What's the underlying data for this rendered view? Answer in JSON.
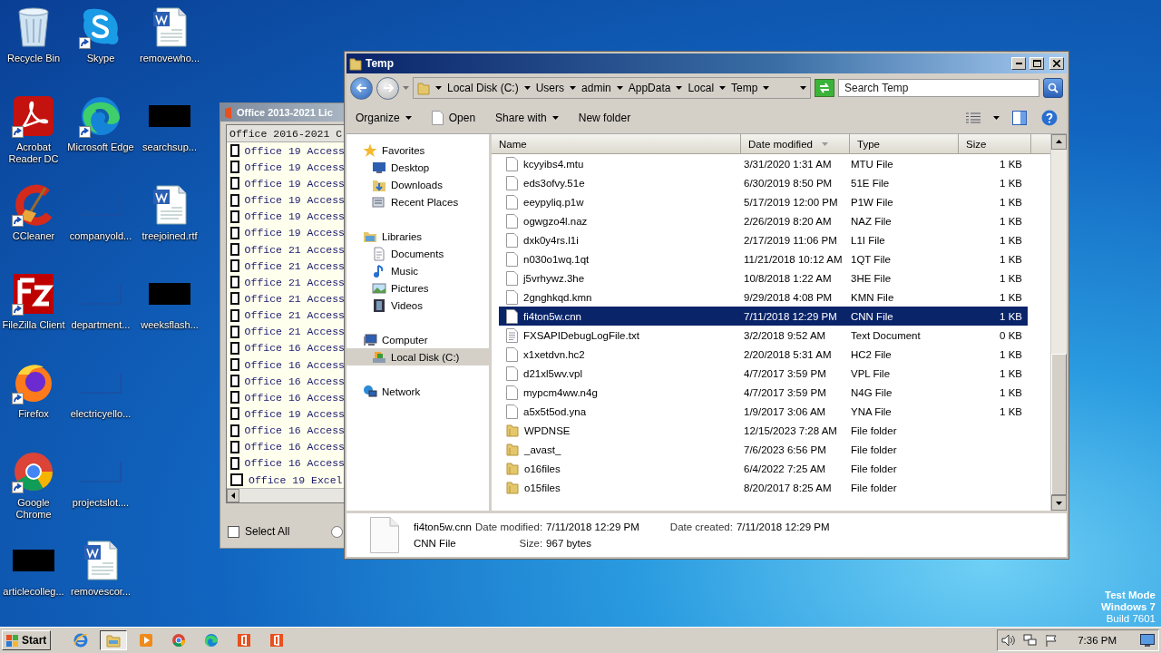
{
  "desktop": {
    "columns": [
      [
        {
          "label": "Recycle Bin",
          "kind": "recycle",
          "shortcut": false
        },
        {
          "label": "Acrobat Reader DC",
          "kind": "acrobat",
          "shortcut": true
        },
        {
          "label": "CCleaner",
          "kind": "ccleaner",
          "shortcut": true
        },
        {
          "label": "FileZilla Client",
          "kind": "filezilla",
          "shortcut": true
        },
        {
          "label": "Firefox",
          "kind": "firefox",
          "shortcut": true
        },
        {
          "label": "Google Chrome",
          "kind": "chrome",
          "shortcut": true
        },
        {
          "label": "articlecolleg...",
          "kind": "dark",
          "shortcut": false
        }
      ],
      [
        {
          "label": "Skype",
          "kind": "skype",
          "shortcut": true
        },
        {
          "label": "Microsoft Edge",
          "kind": "edge",
          "shortcut": true
        },
        {
          "label": "companyold...",
          "kind": "outline",
          "shortcut": false
        },
        {
          "label": "department...",
          "kind": "outline",
          "shortcut": false
        },
        {
          "label": "electricyello...",
          "kind": "outline",
          "shortcut": false
        },
        {
          "label": "projectslot....",
          "kind": "outline",
          "shortcut": false
        },
        {
          "label": "removescor...",
          "kind": "word",
          "shortcut": false
        }
      ],
      [
        {
          "label": "removewho...",
          "kind": "word",
          "shortcut": false
        },
        {
          "label": "searchsup...",
          "kind": "dark",
          "shortcut": false
        },
        {
          "label": "treejoined.rtf",
          "kind": "word",
          "shortcut": false
        },
        {
          "label": "weeksflash...",
          "kind": "dark",
          "shortcut": false
        }
      ]
    ],
    "watermark": [
      "Test Mode",
      "Windows 7",
      "Build 7601"
    ]
  },
  "office_window": {
    "title": "Office 2013-2021 Lic",
    "list_header": "Office 2016-2021 C",
    "items": [
      {
        "label": "Office 19 Access",
        "checked": false
      },
      {
        "label": "Office 19 Access",
        "checked": false
      },
      {
        "label": "Office 19 Access",
        "checked": false
      },
      {
        "label": "Office 19 Access",
        "checked": false
      },
      {
        "label": "Office 19 Access",
        "checked": false
      },
      {
        "label": "Office 19 Access",
        "checked": false
      },
      {
        "label": "Office 21 Access",
        "checked": false
      },
      {
        "label": "Office 21 Access",
        "checked": false
      },
      {
        "label": "Office 21 Access",
        "checked": false
      },
      {
        "label": "Office 21 Access",
        "checked": false
      },
      {
        "label": "Office 21 Access",
        "checked": false
      },
      {
        "label": "Office 21 Access",
        "checked": false
      },
      {
        "label": "Office 16 Access",
        "checked": false
      },
      {
        "label": "Office 16 Access",
        "checked": false
      },
      {
        "label": "Office 16 Access",
        "checked": false
      },
      {
        "label": "Office 16 Access",
        "checked": false
      },
      {
        "label": "Office 19 Access",
        "checked": false
      },
      {
        "label": "Office 16 Access",
        "checked": false
      },
      {
        "label": "Office 16 Access",
        "checked": false
      },
      {
        "label": "Office 16 Access",
        "checked": false
      },
      {
        "label": "Office 19 Excel",
        "checked": false
      }
    ],
    "select_all": {
      "label": "Select All",
      "checked": false
    },
    "radio": {
      "selected": false
    }
  },
  "explorer": {
    "title": "Temp",
    "breadcrumb": [
      "Local Disk (C:)",
      "Users",
      "admin",
      "AppData",
      "Local",
      "Temp"
    ],
    "search": {
      "placeholder": "Search Temp"
    },
    "toolbar": [
      {
        "label": "Organize",
        "kind": "menu"
      },
      {
        "label": "Open",
        "kind": "open"
      },
      {
        "label": "Share with",
        "kind": "menu"
      },
      {
        "label": "New folder",
        "kind": "plain"
      }
    ],
    "nav": [
      {
        "label": "Favorites",
        "kind": "star",
        "selected": false,
        "children": [
          {
            "label": "Desktop",
            "kind": "desktop",
            "selected": false
          },
          {
            "label": "Downloads",
            "kind": "downloads",
            "selected": false
          },
          {
            "label": "Recent Places",
            "kind": "recent",
            "selected": false
          }
        ]
      },
      {
        "label": "Libraries",
        "kind": "libraries",
        "selected": false,
        "children": [
          {
            "label": "Documents",
            "kind": "documents",
            "selected": false
          },
          {
            "label": "Music",
            "kind": "music",
            "selected": false
          },
          {
            "label": "Pictures",
            "kind": "pictures",
            "selected": false
          },
          {
            "label": "Videos",
            "kind": "videos",
            "selected": false
          }
        ]
      },
      {
        "label": "Computer",
        "kind": "computer",
        "selected": false,
        "children": [
          {
            "label": "Local Disk (C:)",
            "kind": "drive",
            "selected": true
          }
        ]
      },
      {
        "label": "Network",
        "kind": "network",
        "selected": false
      }
    ],
    "columns": [
      "Name",
      "Date modified",
      "Type",
      "Size"
    ],
    "files": [
      {
        "name": "kcyyibs4.mtu",
        "date": "3/31/2020 1:31 AM",
        "type": "MTU File",
        "size": "1 KB",
        "kind": "file",
        "selected": false
      },
      {
        "name": "eds3ofvy.51e",
        "date": "6/30/2019 8:50 PM",
        "type": "51E File",
        "size": "1 KB",
        "kind": "file",
        "selected": false
      },
      {
        "name": "eeypyliq.p1w",
        "date": "5/17/2019 12:00 PM",
        "type": "P1W File",
        "size": "1 KB",
        "kind": "file",
        "selected": false
      },
      {
        "name": "ogwgzo4l.naz",
        "date": "2/26/2019 8:20 AM",
        "type": "NAZ File",
        "size": "1 KB",
        "kind": "file",
        "selected": false
      },
      {
        "name": "dxk0y4rs.l1i",
        "date": "2/17/2019 11:06 PM",
        "type": "L1I File",
        "size": "1 KB",
        "kind": "file",
        "selected": false
      },
      {
        "name": "n030o1wq.1qt",
        "date": "11/21/2018 10:12 AM",
        "type": "1QT File",
        "size": "1 KB",
        "kind": "file",
        "selected": false
      },
      {
        "name": "j5vrhywz.3he",
        "date": "10/8/2018 1:22 AM",
        "type": "3HE File",
        "size": "1 KB",
        "kind": "file",
        "selected": false
      },
      {
        "name": "2gnghkqd.kmn",
        "date": "9/29/2018 4:08 PM",
        "type": "KMN File",
        "size": "1 KB",
        "kind": "file",
        "selected": false
      },
      {
        "name": "fi4ton5w.cnn",
        "date": "7/11/2018 12:29 PM",
        "type": "CNN File",
        "size": "1 KB",
        "kind": "file",
        "selected": true
      },
      {
        "name": "FXSAPIDebugLogFile.txt",
        "date": "3/2/2018 9:52 AM",
        "type": "Text Document",
        "size": "0 KB",
        "kind": "text",
        "selected": false
      },
      {
        "name": "x1xetdvn.hc2",
        "date": "2/20/2018 5:31 AM",
        "type": "HC2 File",
        "size": "1 KB",
        "kind": "file",
        "selected": false
      },
      {
        "name": "d21xl5wv.vpl",
        "date": "4/7/2017 3:59 PM",
        "type": "VPL File",
        "size": "1 KB",
        "kind": "file",
        "selected": false
      },
      {
        "name": "mypcm4ww.n4g",
        "date": "4/7/2017 3:59 PM",
        "type": "N4G File",
        "size": "1 KB",
        "kind": "file",
        "selected": false
      },
      {
        "name": "a5x5t5od.yna",
        "date": "1/9/2017 3:06 AM",
        "type": "YNA File",
        "size": "1 KB",
        "kind": "file",
        "selected": false
      },
      {
        "name": "WPDNSE",
        "date": "12/15/2023 7:28 AM",
        "type": "File folder",
        "kind": "folder",
        "selected": false
      },
      {
        "name": "_avast_",
        "date": "7/6/2023 6:56 PM",
        "type": "File folder",
        "kind": "folder",
        "selected": false
      },
      {
        "name": "o16files",
        "date": "6/4/2022 7:25 AM",
        "type": "File folder",
        "kind": "folder",
        "selected": false
      },
      {
        "name": "o15files",
        "date": "8/20/2017 8:25 AM",
        "type": "File folder",
        "kind": "folder",
        "selected": false
      }
    ],
    "details": {
      "name": "fi4ton5w.cnn",
      "type": "CNN File",
      "fields": [
        {
          "label": "Date modified:",
          "value": "7/11/2018 12:29 PM"
        },
        {
          "label": "Date created:",
          "value": "7/11/2018 12:29 PM"
        },
        {
          "label": "Size:",
          "value": "967 bytes"
        }
      ]
    }
  },
  "taskbar": {
    "start": "Start",
    "items": [
      {
        "kind": "ie",
        "selected": false
      },
      {
        "kind": "explorer",
        "selected": true
      },
      {
        "kind": "media",
        "selected": false
      },
      {
        "kind": "chrome",
        "selected": false
      },
      {
        "kind": "edge",
        "selected": false
      },
      {
        "kind": "office",
        "selected": false
      },
      {
        "kind": "office",
        "selected": false
      }
    ],
    "clock": "7:36 PM"
  }
}
